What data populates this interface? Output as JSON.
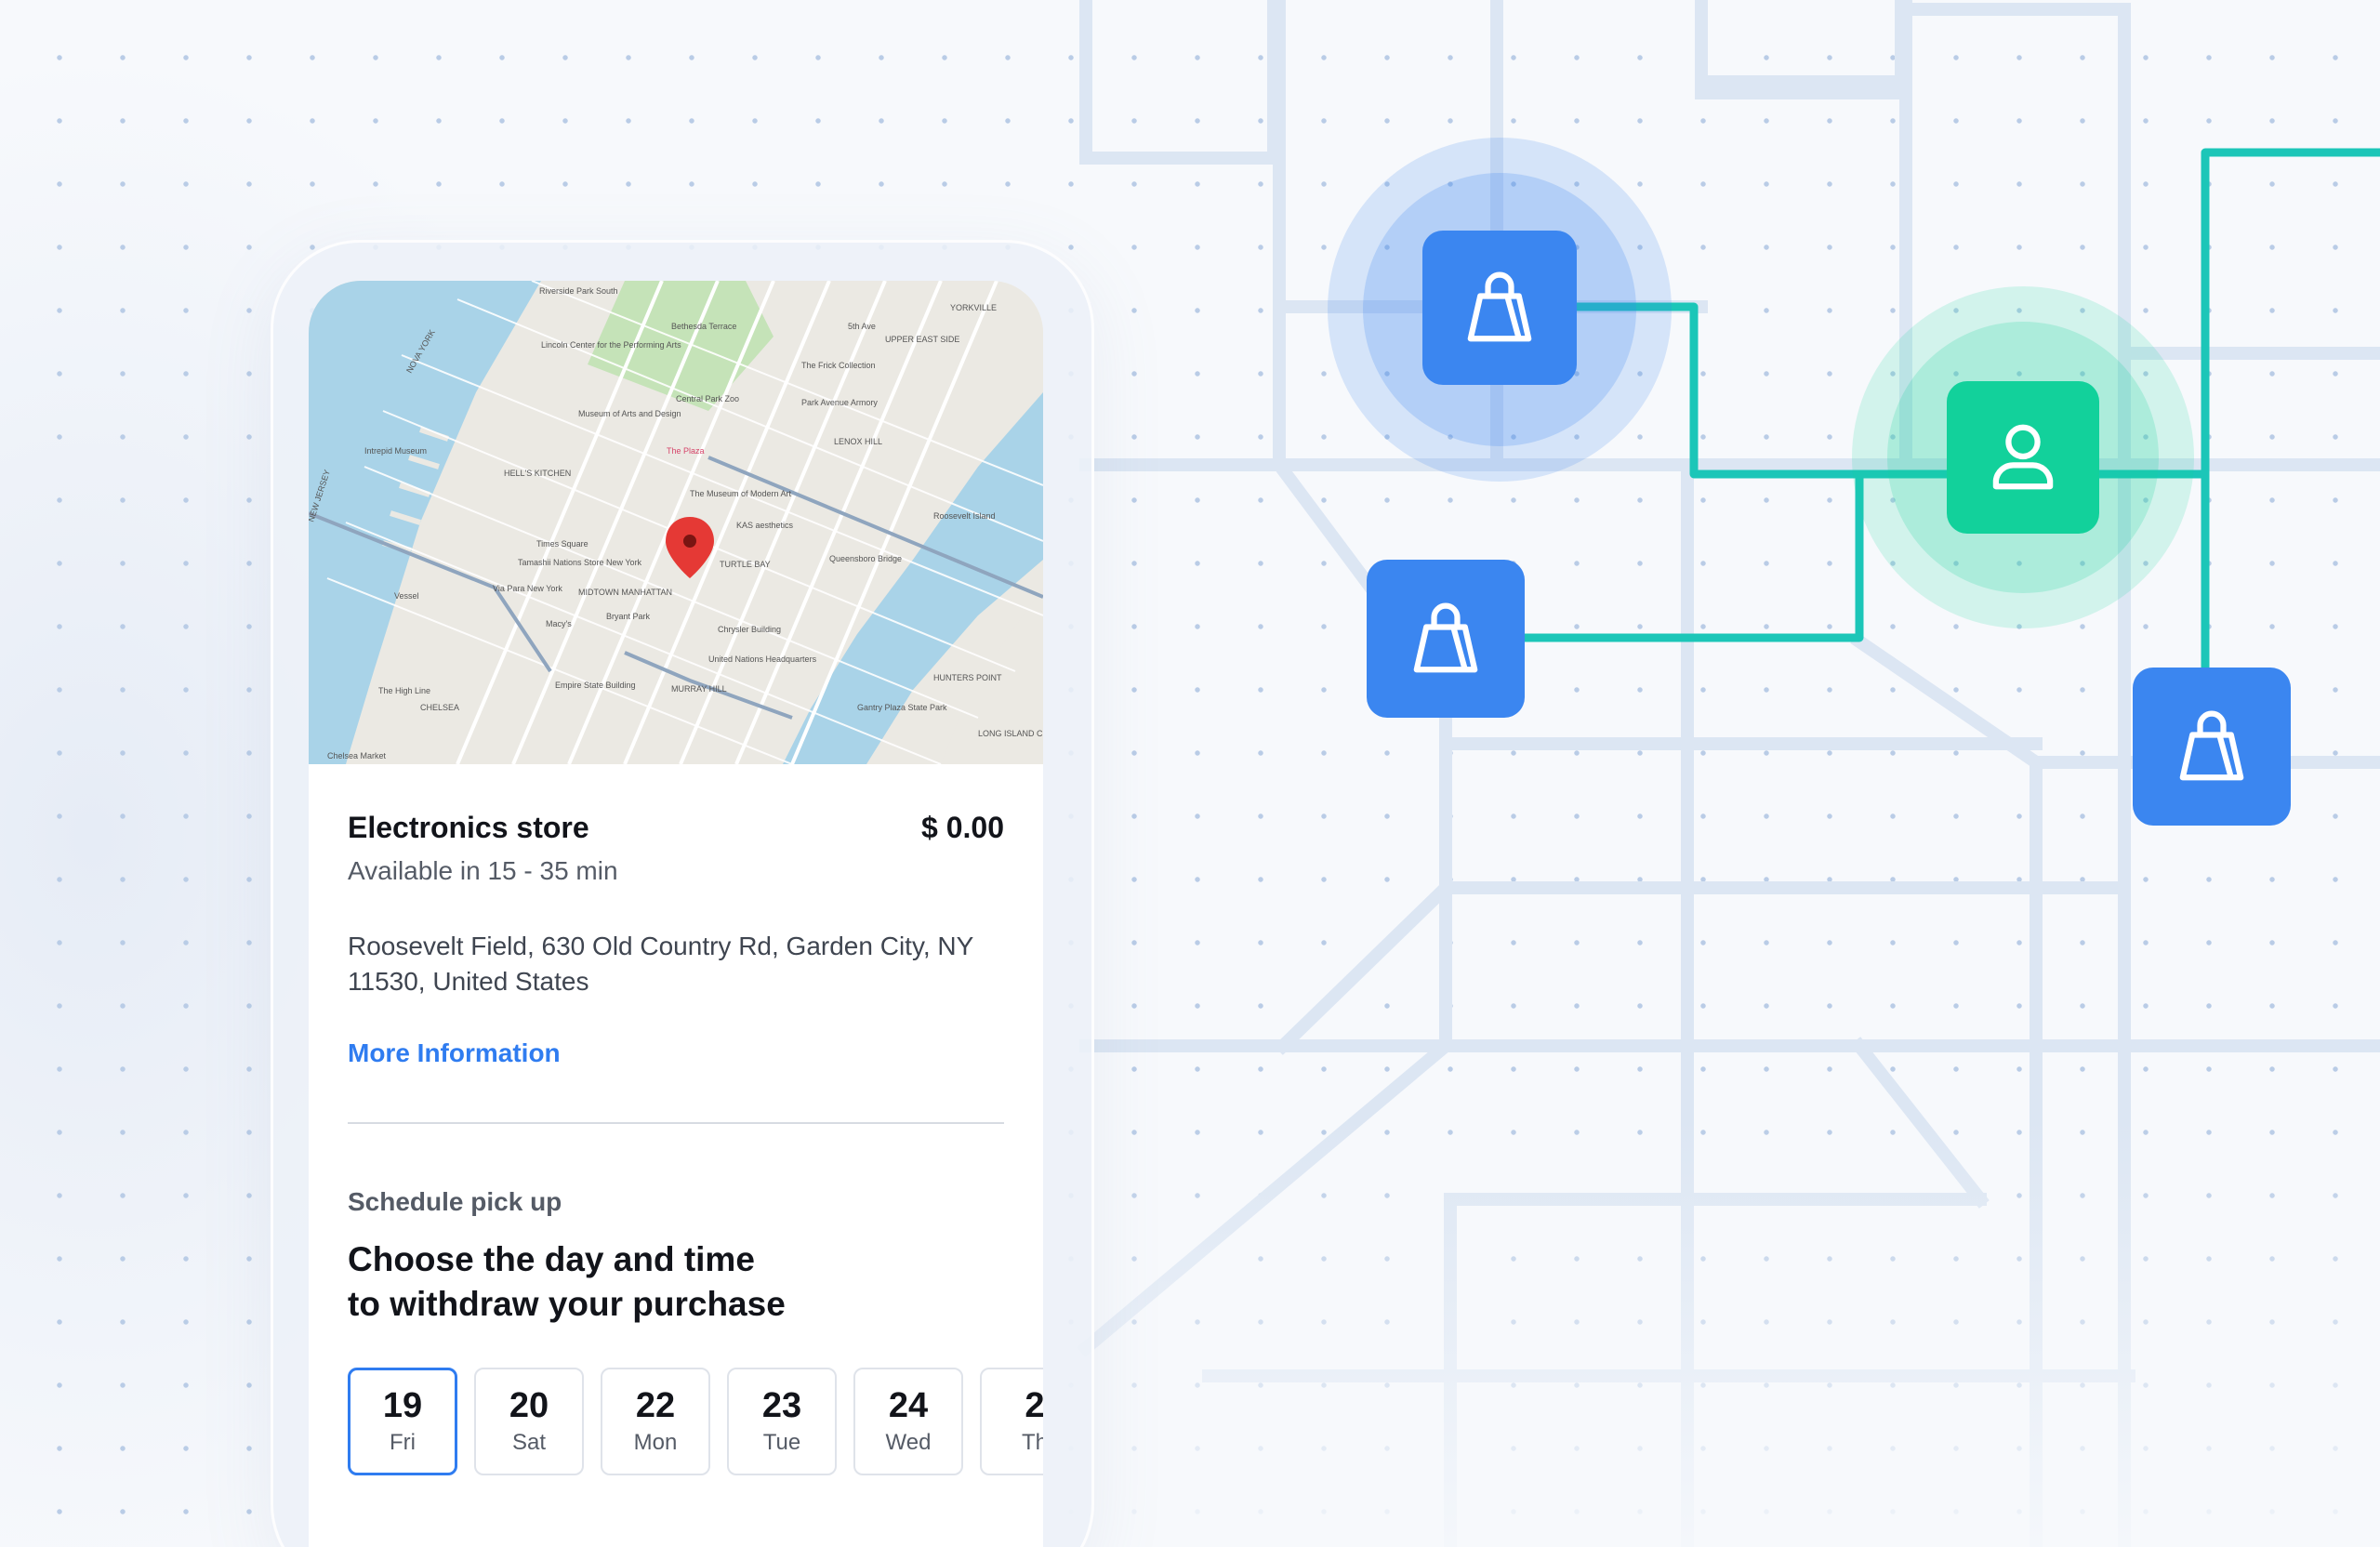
{
  "map": {
    "labels": [
      "Riverside Park South",
      "YORKVILLE",
      "Bethesda Terrace",
      "5th Ave",
      "UPPER EAST SIDE",
      "Lincoln Center for the Performing Arts",
      "The Frick Collection",
      "Central Park Zoo",
      "Park Avenue Armory",
      "Museum of Arts and Design",
      "LENOX HILL",
      "Intrepid Museum",
      "HELL'S KITCHEN",
      "The Plaza",
      "The Museum of Modern Art",
      "KAS aesthetics",
      "Roosevelt Island",
      "Times Square",
      "TURTLE BAY",
      "Queensboro Bridge",
      "Tamashii Nations Store New York",
      "Via Para New York",
      "MIDTOWN MANHATTAN",
      "Vessel",
      "Bryant Park",
      "Macy's",
      "Chrysler Building",
      "United Nations Headquarters",
      "The High Line",
      "Empire State Building",
      "MURRAY HILL",
      "HUNTERS POINT",
      "CHELSEA",
      "Gantry Plaza State Park",
      "LONG ISLAND CITY",
      "Chelsea Market",
      "NEW JERSEY",
      "NOVA YORK"
    ],
    "pin_icon": "map-pin-icon"
  },
  "store": {
    "name": "Electronics store",
    "price": "$ 0.00",
    "availability": "Available in 15 - 35 min",
    "address": "Roosevelt Field, 630 Old Country Rd, Garden City, NY 11530, United States",
    "more_info": "More Information"
  },
  "schedule": {
    "label": "Schedule pick up",
    "title_line1": "Choose the day and time",
    "title_line2": "to withdraw your purchase",
    "days": [
      {
        "num": "19",
        "name": "Fri",
        "selected": true
      },
      {
        "num": "20",
        "name": "Sat"
      },
      {
        "num": "22",
        "name": "Mon"
      },
      {
        "num": "23",
        "name": "Tue"
      },
      {
        "num": "24",
        "name": "Wed"
      },
      {
        "num": "2",
        "name": "Th"
      }
    ]
  },
  "network": {
    "store_icon": "shopping-bag-icon",
    "user_icon": "user-icon",
    "colors": {
      "blue": "#3b86f0",
      "green": "#12d19b",
      "teal_line": "#1cc6b8"
    }
  }
}
